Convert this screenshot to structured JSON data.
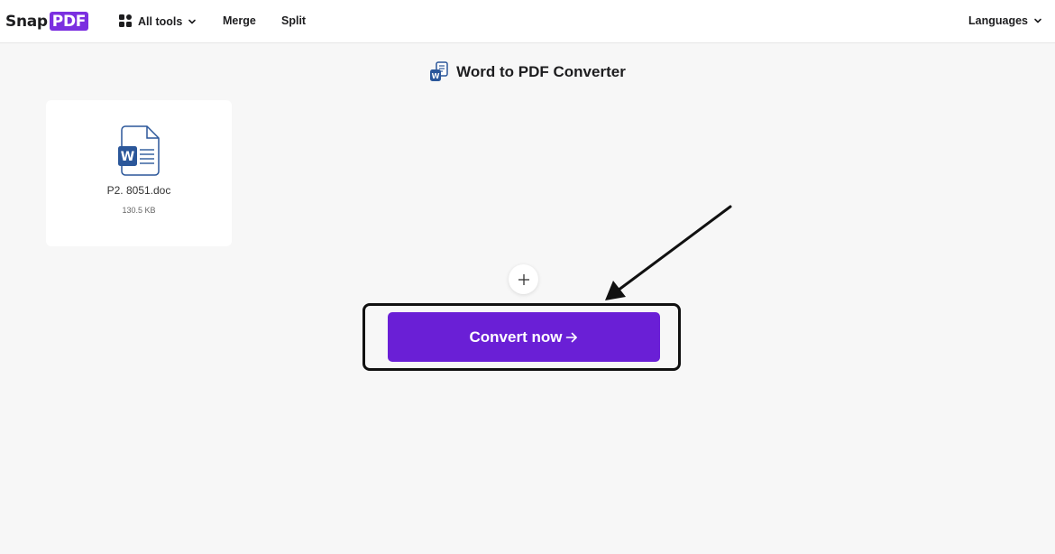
{
  "header": {
    "logo_snap": "Snap",
    "logo_pdf": "PDF",
    "nav": {
      "all_tools": "All tools",
      "merge": "Merge",
      "split": "Split",
      "languages": "Languages"
    }
  },
  "page_title": "Word to PDF Converter",
  "file": {
    "name": "P2. 8051.doc",
    "size": "130.5 KB",
    "icon_letter": "W"
  },
  "actions": {
    "convert_label": "Convert now"
  },
  "colors": {
    "brand_purple": "#6a1fd6",
    "logo_purple": "#7b2fe0",
    "word_blue": "#2b579a"
  }
}
